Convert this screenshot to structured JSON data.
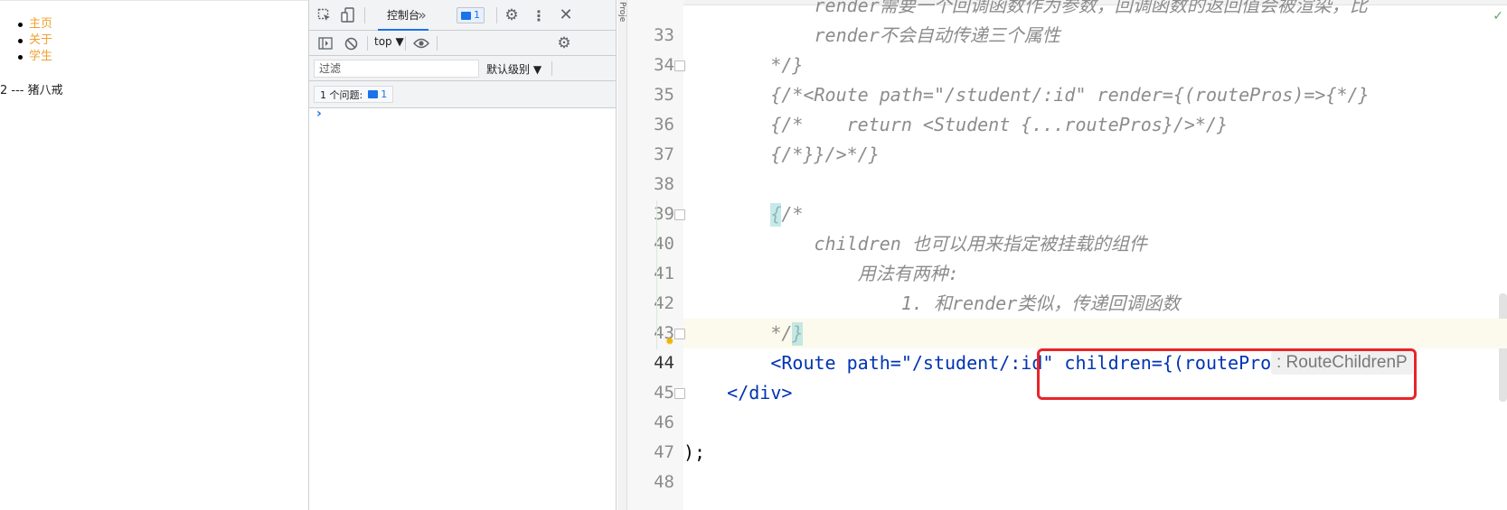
{
  "page": {
    "nav": [
      "主页",
      "关于",
      "学生"
    ],
    "student_line": "2 --- 猪八戒"
  },
  "devtools": {
    "tabs": {
      "console_label": "控制台",
      "more_tabs": "»",
      "issue_count": "1"
    },
    "toolbar": {
      "context_label": "top ▼"
    },
    "filter": {
      "placeholder": "过滤",
      "level_label": "默认级别 ▼"
    },
    "issues": {
      "label": "1 个问题:",
      "count": "1"
    },
    "prompt": "›"
  },
  "editor": {
    "lines": [
      {
        "n": "33",
        "text": "            render需要一个回调函数作为参数，回调函数的返回值会被渲染，比"
      },
      {
        "n": "34",
        "text": "            render不会自动传递三个属性"
      },
      {
        "n": "35",
        "text": "        */}"
      },
      {
        "n": "36",
        "text": "        {/*<Route path=\"/student/:id\" render={(routePros)=>{*/}"
      },
      {
        "n": "37",
        "text": "        {/*    return <Student {...routePros}/>*/}"
      },
      {
        "n": "38",
        "text": "        {/*}}/>*/}"
      },
      {
        "n": "39",
        "text": ""
      },
      {
        "n": "40",
        "text": "        {/*"
      },
      {
        "n": "41",
        "text": "            children 也可以用来指定被挂载的组件"
      },
      {
        "n": "42",
        "text": "                用法有两种:"
      },
      {
        "n": "43",
        "text": "                    1. 和render类似，传递回调函数"
      },
      {
        "n": "44",
        "text": "        */}"
      },
      {
        "n": "45",
        "text": "        <Route path=\"/student/:id\" children={(routeProps"
      },
      {
        "n": "46",
        "text": "    </div>"
      },
      {
        "n": "47",
        "text": ""
      },
      {
        "n": "48",
        "text": ");"
      }
    ],
    "type_hint": ": RouteChildrenP"
  }
}
